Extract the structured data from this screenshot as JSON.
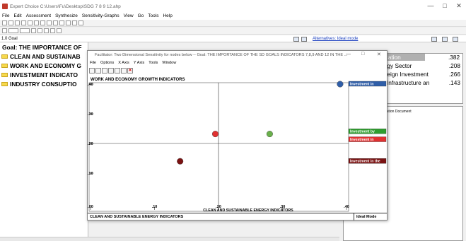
{
  "window": {
    "title": "Expert Choice   C:\\Users\\Fu\\Desktop\\SDG 7 8 9 12.ahp",
    "controls": [
      "—",
      "□",
      "✕"
    ]
  },
  "menu": [
    "File",
    "Edit",
    "Assessment",
    "Synthesize",
    "Sensitivity-Graphs",
    "View",
    "Go",
    "Tools",
    "Help"
  ],
  "goalbar": {
    "label": "1.0 Goal",
    "alternatives_link": "Alternatives: Ideal mode"
  },
  "tree": {
    "goal": "Goal: THE IMPORTANCE OF",
    "items": [
      "CLEAN AND SUSTAINAB",
      "WORK AND ECONOMY G",
      "INVESTMENT INDICATO",
      "INDUSTRY CONSUPTIO"
    ]
  },
  "alternatives": {
    "rows": [
      {
        "label": "ucation",
        "value": ".382"
      },
      {
        "label": "ergy Sector",
        "value": ".208"
      },
      {
        "label": "oreign Investment",
        "value": ".266"
      },
      {
        "label": "e Infrastructure an",
        "value": ".143"
      }
    ]
  },
  "infodoc": {
    "label": "ormation Document"
  },
  "sensitivity": {
    "title": "Facilitator: Two Dimensional Sensitivity for nodes below -- Goal: THE IMPORTANCE OF THE SD GOALS INDICATORS 7,8,9 AND 12 IN THE ...",
    "controls": [
      "—",
      "□",
      "✕"
    ],
    "menu": [
      "File",
      "Options",
      "X Axis",
      "Y Axis",
      "Tools",
      "Window"
    ],
    "status_left": "CLEAN AND SUSTAINABLE ENERGY INDICATORS",
    "status_right": "Ideal Mode"
  },
  "chart_data": {
    "type": "scatter",
    "title": "WORK AND ECONOMY GROWTH INDICATORS",
    "xlabel": "CLEAN AND SUSTAINABLE ENERGY INDICATORS",
    "ylabel": "WORK AND ECONOMY GROWTH INDICATORS",
    "xlim": [
      0,
      0.4
    ],
    "ylim": [
      0,
      0.4
    ],
    "xticks": [
      ".00",
      ".10",
      ".20",
      ".30",
      ".40"
    ],
    "yticks": [
      ".10",
      ".20",
      ".30",
      ".40"
    ],
    "points": [
      {
        "x": 0.39,
        "y": 0.4,
        "color": "#2f5ea8"
      },
      {
        "x": 0.28,
        "y": 0.232,
        "color": "#6ab04c"
      },
      {
        "x": 0.195,
        "y": 0.232,
        "color": "#e03131"
      },
      {
        "x": 0.14,
        "y": 0.14,
        "color": "#7a1212"
      }
    ],
    "crosshair": {
      "x": 0.2,
      "y": 0.2
    },
    "legend": [
      {
        "label": "Investment in",
        "color": "#2f5ea8",
        "y": 0.4
      },
      {
        "label": "Investment by",
        "color": "#2e9e2e",
        "y": 0.24
      },
      {
        "label": "Investment in",
        "color": "#e03131",
        "y": 0.232
      },
      {
        "label": "Investment in the",
        "color": "#7a1212",
        "y": 0.14
      }
    ]
  }
}
